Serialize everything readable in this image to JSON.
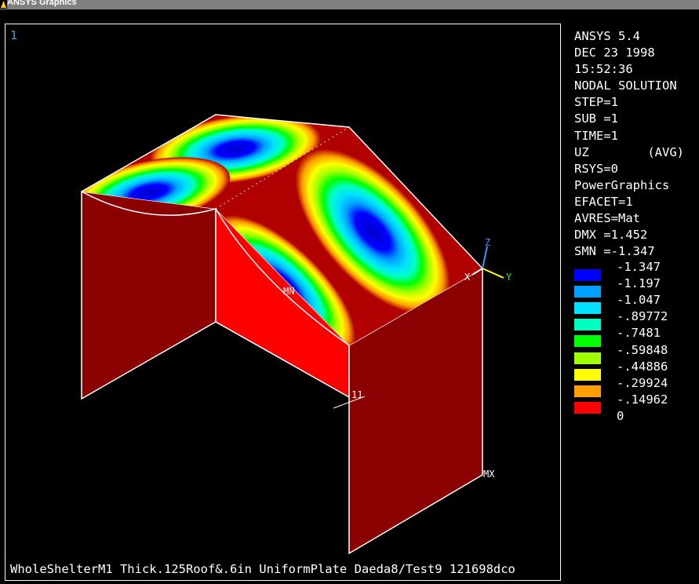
{
  "window": {
    "title": "ANSYS Graphics"
  },
  "viewport": {
    "number": "1"
  },
  "info": [
    "ANSYS 5.4",
    "DEC 23 1998",
    "15:52:36",
    "NODAL SOLUTION",
    "STEP=1",
    "SUB =1",
    "TIME=1",
    "UZ        (AVG)",
    "RSYS=0",
    "PowerGraphics",
    "EFACET=1",
    "AVRES=Mat",
    "DMX =1.452",
    "SMN =-1.347"
  ],
  "legend": [
    {
      "color": "#0000ff",
      "label": "-1.347"
    },
    {
      "color": "#00a0ff",
      "label": "-1.197"
    },
    {
      "color": "#00e0ff",
      "label": "-1.047"
    },
    {
      "color": "#00ffc0",
      "label": "-.89772"
    },
    {
      "color": "#00ff00",
      "label": "-.7481"
    },
    {
      "color": "#a0ff00",
      "label": "-.59848"
    },
    {
      "color": "#ffff00",
      "label": "-.44886"
    },
    {
      "color": "#ffa000",
      "label": "-.29924"
    },
    {
      "color": "#ff0000",
      "label": "-.14962"
    }
  ],
  "legend_end": "0",
  "labels": {
    "min": "MN",
    "max": "MX",
    "node": "11",
    "axis_x": "X",
    "axis_y": "Y",
    "axis_z": "Z"
  },
  "footer": "WholeShelterM1 Thick.125Roof&.6in UniformPlate Daeda8/Test9 121698dco",
  "colors": {
    "wall_dark": "#8b0000",
    "wall_bright": "#ff0000",
    "roof": "#b00000"
  }
}
